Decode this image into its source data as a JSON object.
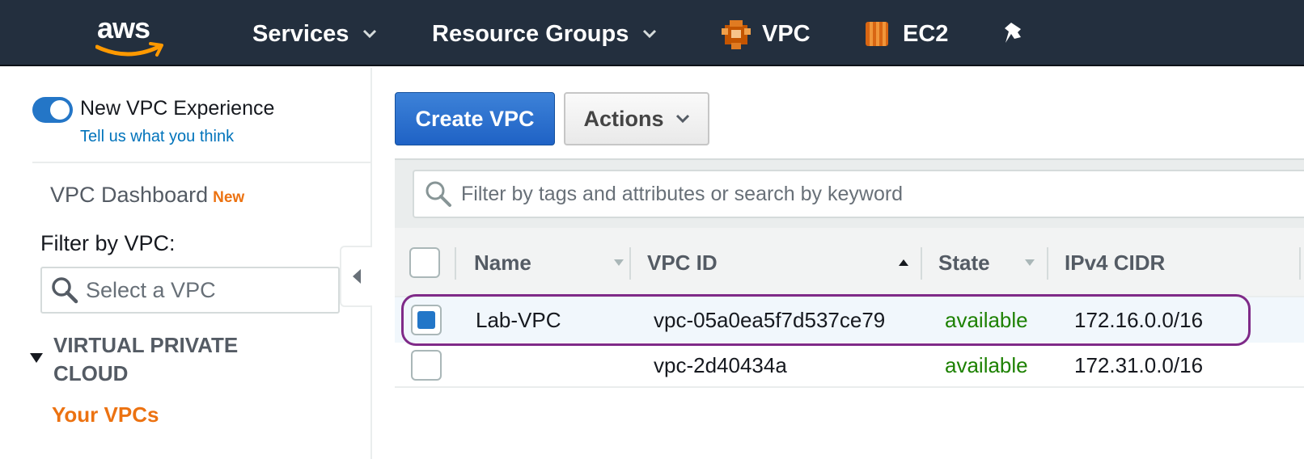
{
  "colors": {
    "nav_bg": "#232f3e",
    "accent_blue": "#2276c8",
    "accent_orange": "#ec7211",
    "status_green": "#1d8102",
    "highlight_purple": "#7f2a88"
  },
  "nav": {
    "logo": "aws",
    "services_label": "Services",
    "resource_groups_label": "Resource Groups",
    "vpc_label": "VPC",
    "ec2_label": "EC2",
    "pin_icon": "pin-icon"
  },
  "sidebar": {
    "toggle_label": "New VPC Experience",
    "toggle_on": true,
    "feedback_link": "Tell us what you think",
    "dashboard_label": "VPC Dashboard",
    "dashboard_badge": "New",
    "filter_label": "Filter by VPC:",
    "filter_placeholder": "Select a VPC",
    "section_title": "VIRTUAL PRIVATE CLOUD",
    "active_item": "Your VPCs"
  },
  "toolbar": {
    "create_label": "Create VPC",
    "actions_label": "Actions"
  },
  "search": {
    "placeholder": "Filter by tags and attributes or search by keyword"
  },
  "table": {
    "columns": [
      "Name",
      "VPC ID",
      "State",
      "IPv4 CIDR"
    ],
    "rows": [
      {
        "selected": true,
        "name": "Lab-VPC",
        "vpc_id": "vpc-05a0ea5f7d537ce79",
        "state": "available",
        "cidr": "172.16.0.0/16"
      },
      {
        "selected": false,
        "name": "",
        "vpc_id": "vpc-2d40434a",
        "state": "available",
        "cidr": "172.31.0.0/16"
      }
    ]
  }
}
